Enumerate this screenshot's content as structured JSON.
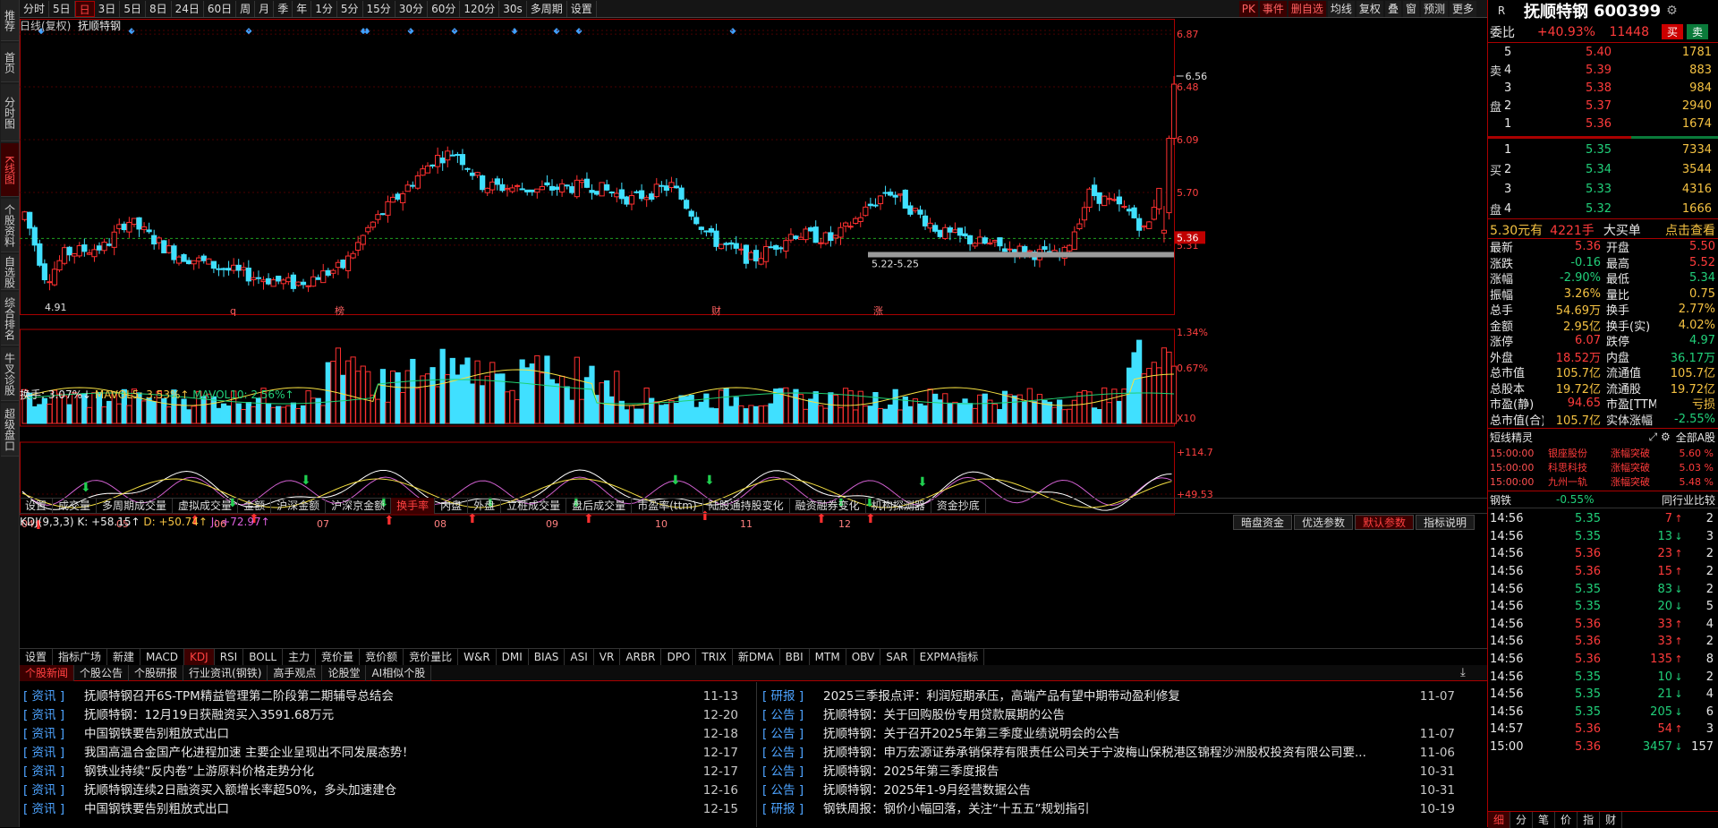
{
  "left_sidebar": [
    "推荐",
    "首页",
    "分时图",
    "K线图",
    "个股资料",
    "自选股",
    "综合排名",
    "牛叉诊股",
    "超级盘口"
  ],
  "toolbar": {
    "periods": [
      "分时",
      "5日",
      "日",
      "3日",
      "5日",
      "8日",
      "24日",
      "60日",
      "周",
      "月",
      "季",
      "年",
      "1分",
      "5分",
      "15分",
      "30分",
      "60分",
      "120分",
      "30s",
      "多周期",
      "设置"
    ],
    "active_period": "日",
    "right_tools": [
      "PK",
      "事件",
      "删自选",
      "均线",
      "复权",
      "叠",
      "窗",
      "预测",
      "更多"
    ]
  },
  "kline": {
    "title": "日线(复权)",
    "stock": "抚顺特钢",
    "price_scale": [
      "6.87",
      "6.48",
      "6.09",
      "5.70",
      "5.31"
    ],
    "current_price_label": "5.36",
    "high_label": "6.56",
    "low_label": "4.91",
    "zone_label": "5.22-5.25",
    "event_markers": [
      "q",
      "榜",
      "财",
      "涨"
    ],
    "up_color": "#ff3030",
    "down_color": "#40e0ff"
  },
  "volume": {
    "legend_turnover": "换手: 3.07%↓",
    "legend_mavol5": "MAVOL5: 3.53%↑",
    "legend_mavol10": "MAVOL10: 2.56%↑",
    "scale": [
      "1.34%",
      "0.67%"
    ],
    "multiplier": "X10"
  },
  "volume_tabs": [
    "设置",
    "成交量",
    "多周期成交量",
    "虚拟成交量",
    "金额",
    "沪深金额",
    "沪深京金额",
    "换手率",
    "内盘",
    "外盘",
    "立桩成交量",
    "盘后成交量",
    "市盈率(ttm)",
    "陆股通持股变化",
    "融资融券变化",
    "机构探测器",
    "资金抄底"
  ],
  "volume_active_tab": "换手率",
  "kdj": {
    "legend_name": "KDJ(9,3,3)",
    "k": "K: +58.15↑",
    "d": "D: +50.74↑",
    "j": "J: +72.97↑",
    "scale": [
      "+114.7",
      "+49.53"
    ],
    "buttons": [
      "暗盘资金",
      "优选参数",
      "默认参数",
      "指标说明"
    ],
    "x_labels": [
      "04",
      "05",
      "06",
      "07",
      "08",
      "09",
      "10",
      "11",
      "12"
    ]
  },
  "indicator_tabs": [
    "设置",
    "指标广场",
    "新建",
    "MACD",
    "KDJ",
    "RSI",
    "BOLL",
    "主力",
    "竞价量",
    "竞价额",
    "竞价量比",
    "W&R",
    "DMI",
    "BIAS",
    "ASI",
    "VR",
    "ARBR",
    "DPO",
    "TRIX",
    "新DMA",
    "BBI",
    "MTM",
    "OBV",
    "SAR",
    "EXPMA指标"
  ],
  "indicator_active_tab": "KDJ",
  "news_tabs": [
    "个股新闻",
    "个股公告",
    "个股研报",
    "行业资讯(钢铁)",
    "高手观点",
    "论股堂",
    "AI相似个股"
  ],
  "news_left": [
    {
      "tag": "[ 资讯 ]",
      "title": "抚顺特钢召开6S-TPM精益管理第二阶段第二期辅导总结会",
      "date": "11-13"
    },
    {
      "tag": "[ 资讯 ]",
      "title": "抚顺特钢：12月19日获融资买入3591.68万元",
      "date": "12-20"
    },
    {
      "tag": "[ 资讯 ]",
      "title": "中国钢铁要告别粗放式出口",
      "date": "12-18"
    },
    {
      "tag": "[ 资讯 ]",
      "title": "我国高温合金国产化进程加速 主要企业呈现出不同发展态势！",
      "date": "12-17"
    },
    {
      "tag": "[ 资讯 ]",
      "title": "钢铁业持续“反内卷”上游原料价格走势分化",
      "date": "12-17"
    },
    {
      "tag": "[ 资讯 ]",
      "title": "抚顺特钢连续2日融资买入额增长率超50%，多头加速建仓",
      "date": "12-16"
    },
    {
      "tag": "[ 资讯 ]",
      "title": "中国钢铁要告别粗放式出口",
      "date": "12-15"
    }
  ],
  "news_right": [
    {
      "tag": "[ 研报 ]",
      "title": "2025三季报点评：利润短期承压，高端产品有望中期带动盈利修复",
      "date": "11-07"
    },
    {
      "tag": "[ 公告 ]",
      "title": "抚顺特钢：关于回购股份专用贷款展期的公告",
      "date": ""
    },
    {
      "tag": "[ 公告 ]",
      "title": "抚顺特钢：关于召开2025年第三季度业绩说明会的公告",
      "date": "11-07"
    },
    {
      "tag": "[ 公告 ]",
      "title": "抚顺特钢：申万宏源证券承销保荐有限责任公司关于宁波梅山保税港区锦程沙洲股权投资有限公司要...",
      "date": "11-06"
    },
    {
      "tag": "[ 公告 ]",
      "title": "抚顺特钢：2025年第三季度报告",
      "date": "10-31"
    },
    {
      "tag": "[ 公告 ]",
      "title": "抚顺特钢：2025年1-9月经营数据公告",
      "date": "10-31"
    },
    {
      "tag": "[ 研报 ]",
      "title": "钢铁周报：钢价小幅回落，关注“十五五”规划指引",
      "date": "10-19"
    }
  ],
  "quote": {
    "r_badge": "R",
    "name": "抚顺特钢",
    "code": "600399",
    "weibi_label": "委比",
    "weibi": "+40.93%",
    "weicha": "11448",
    "buy_btn": "买",
    "sell_btn": "卖",
    "sell_side_label": [
      "卖",
      "盘"
    ],
    "buy_side_label": [
      "买",
      "盘"
    ],
    "asks": [
      {
        "lvl": "5",
        "price": "5.40",
        "vol": "1781"
      },
      {
        "lvl": "4",
        "price": "5.39",
        "vol": "883"
      },
      {
        "lvl": "3",
        "price": "5.38",
        "vol": "984"
      },
      {
        "lvl": "2",
        "price": "5.37",
        "vol": "2940"
      },
      {
        "lvl": "1",
        "price": "5.36",
        "vol": "1674"
      }
    ],
    "bids": [
      {
        "lvl": "1",
        "price": "5.35",
        "vol": "7334"
      },
      {
        "lvl": "2",
        "price": "5.34",
        "vol": "3544"
      },
      {
        "lvl": "3",
        "price": "5.33",
        "vol": "4316"
      },
      {
        "lvl": "4",
        "price": "5.32",
        "vol": "1666"
      }
    ],
    "big_buy": {
      "price": "5.30元有",
      "vol": "4221手",
      "label": "大买单",
      "link": "点击查看"
    },
    "stats": [
      [
        "最新",
        "5.36",
        "开盘",
        "5.50"
      ],
      [
        "涨跌",
        "-0.16",
        "最高",
        "5.52"
      ],
      [
        "涨幅",
        "-2.90%",
        "最低",
        "5.34"
      ],
      [
        "振幅",
        "3.26%",
        "量比",
        "0.75"
      ],
      [
        "总手",
        "54.69万",
        "换手",
        "2.77%"
      ],
      [
        "金额",
        "2.95亿",
        "换手(实)",
        "4.02%"
      ],
      [
        "涨停",
        "6.07",
        "跌停",
        "4.97"
      ],
      [
        "外盘",
        "18.52万",
        "内盘",
        "36.17万"
      ],
      [
        "总市值",
        "105.7亿",
        "流通值",
        "105.7亿"
      ],
      [
        "总股本",
        "19.72亿",
        "流通股",
        "19.72亿"
      ],
      [
        "市盈(静)",
        "94.65",
        "市盈[TTM]",
        "亏损"
      ],
      [
        "总市值(合)",
        "105.7亿",
        "实体涨幅",
        "-2.55%"
      ]
    ],
    "jingling_title": "短线精灵",
    "jingling_filter": "全部A股",
    "jingling": [
      {
        "time": "15:00:00",
        "name": "银座股份",
        "event": "涨幅突破",
        "val": "5.60 %"
      },
      {
        "time": "15:00:00",
        "name": "科思科技",
        "event": "涨幅突破",
        "val": "5.03 %"
      },
      {
        "time": "15:00:00",
        "name": "九州一轨",
        "event": "涨幅突破",
        "val": "5.48 %"
      }
    ],
    "industry": {
      "name": "钢铁",
      "chg": "-0.55%",
      "link": "同行业比较"
    },
    "ticks": [
      {
        "t": "14:56",
        "p": "5.35",
        "v": "7",
        "d": "up",
        "n": "2"
      },
      {
        "t": "14:56",
        "p": "5.35",
        "v": "13",
        "d": "down",
        "n": "3"
      },
      {
        "t": "14:56",
        "p": "5.36",
        "v": "23",
        "d": "up",
        "n": "2"
      },
      {
        "t": "14:56",
        "p": "5.36",
        "v": "15",
        "d": "up",
        "n": "2"
      },
      {
        "t": "14:56",
        "p": "5.35",
        "v": "83",
        "d": "down",
        "n": "2"
      },
      {
        "t": "14:56",
        "p": "5.35",
        "v": "20",
        "d": "down",
        "n": "5"
      },
      {
        "t": "14:56",
        "p": "5.36",
        "v": "33",
        "d": "up",
        "n": "4"
      },
      {
        "t": "14:56",
        "p": "5.36",
        "v": "33",
        "d": "up",
        "n": "2"
      },
      {
        "t": "14:56",
        "p": "5.36",
        "v": "135",
        "d": "up",
        "n": "8"
      },
      {
        "t": "14:56",
        "p": "5.35",
        "v": "10",
        "d": "down",
        "n": "2"
      },
      {
        "t": "14:56",
        "p": "5.35",
        "v": "21",
        "d": "down",
        "n": "4"
      },
      {
        "t": "14:56",
        "p": "5.35",
        "v": "205",
        "d": "down",
        "n": "6"
      },
      {
        "t": "14:57",
        "p": "5.36",
        "v": "54",
        "d": "up",
        "n": "3"
      },
      {
        "t": "15:00",
        "p": "5.36",
        "v": "3457",
        "d": "down",
        "n": "157"
      }
    ],
    "bottom_tabs": [
      "细",
      "分",
      "笔",
      "价",
      "指",
      "财"
    ]
  }
}
